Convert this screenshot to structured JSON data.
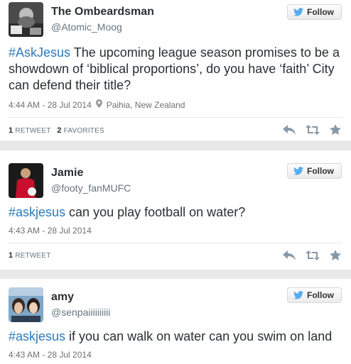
{
  "tweets": [
    {
      "display_name": "The Ombeardsman",
      "screen_name": "@Atomic_Moog",
      "follow_label": "Follow",
      "hashtag": "#AskJesus",
      "body": " The upcoming league season promises to be a showdown of ‘biblical proportions’, do you have ‘faith’ City can defend their title?",
      "timestamp": "4:44 AM - 28 Jul 2014",
      "location": "Paihia, New Zealand",
      "retweets_count": "1",
      "retweets_label": "RETWEET",
      "favorites_count": "2",
      "favorites_label": "FAVORITES"
    },
    {
      "display_name": "Jamie",
      "screen_name": "@footy_fanMUFC",
      "follow_label": "Follow",
      "hashtag": "#askjesus",
      "body": " can you play football on water?",
      "timestamp": "4:43 AM - 28 Jul 2014",
      "retweets_count": "1",
      "retweets_label": "RETWEET"
    },
    {
      "display_name": "amy",
      "screen_name": "@senpaiiiiiiiiii",
      "follow_label": "Follow",
      "hashtag": "#askjesus",
      "body": " if you can walk on water can you swim on land",
      "timestamp": "4:43 AM - 28 Jul 2014"
    }
  ],
  "colors": {
    "hashtag": "#2b7bb9",
    "twitter_bird": "#55acee",
    "separator": "#e8e8e8"
  },
  "icons": [
    "twitter-bird-icon",
    "location-pin-icon",
    "reply-icon",
    "retweet-icon",
    "favorite-star-icon"
  ]
}
